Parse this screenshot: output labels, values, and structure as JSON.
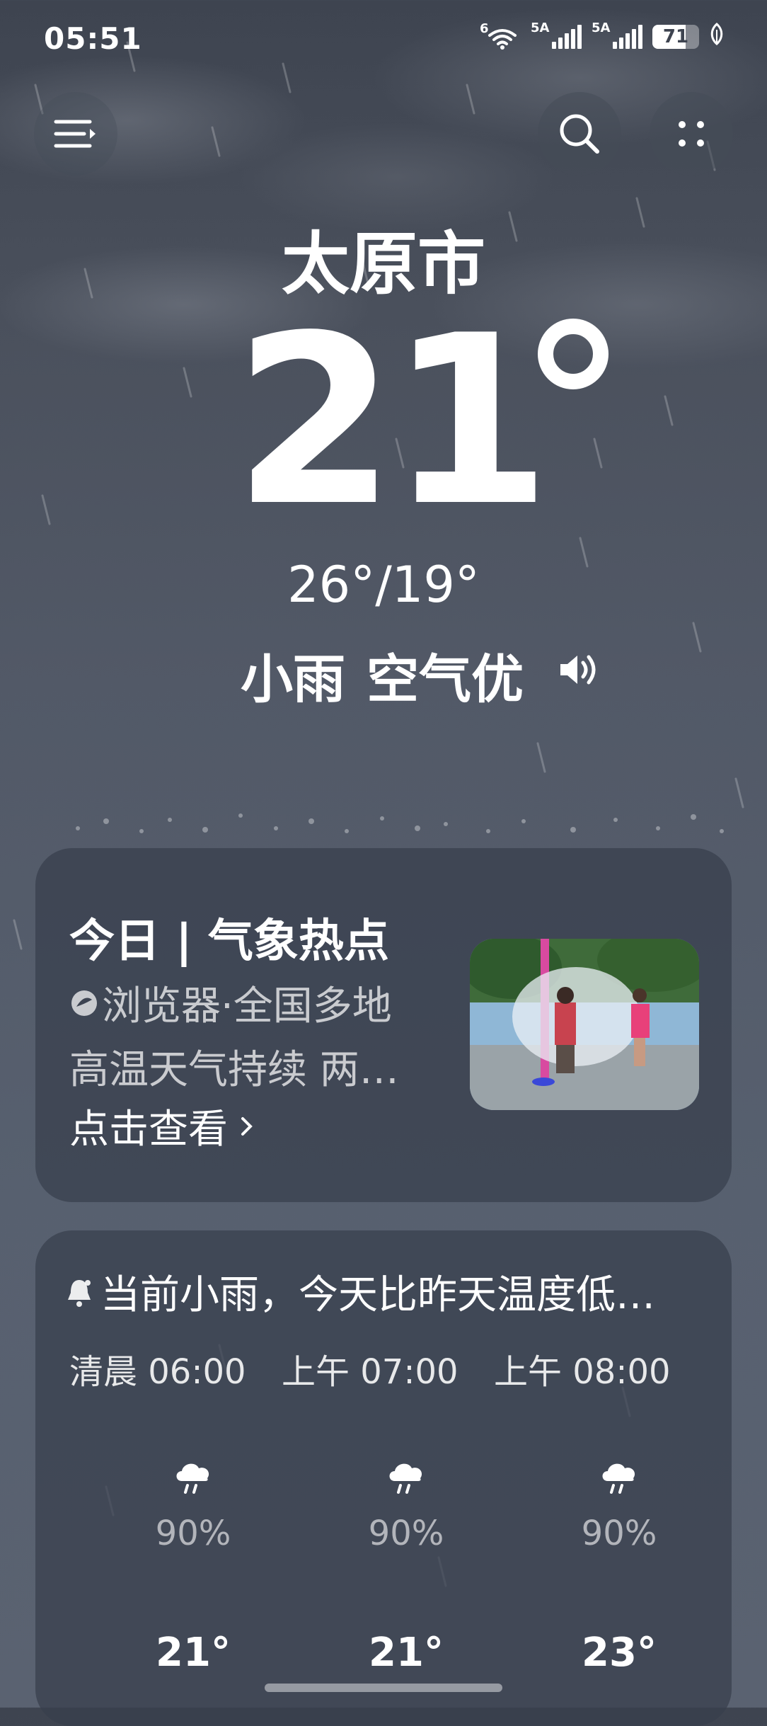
{
  "status_bar": {
    "time": "05:51",
    "wifi_label": "6",
    "signal1_label": "5A",
    "signal2_label": "5A",
    "battery": "71",
    "battery_level": 0.71
  },
  "header": {
    "city": "太原市",
    "menu_icon": "menu-icon",
    "search_icon": "search-icon",
    "more_icon": "grid-dots-icon"
  },
  "current": {
    "temperature": "21",
    "range": "26°/19°",
    "condition": "小雨",
    "air_quality": "空气优",
    "speaker_icon": "speaker-icon"
  },
  "hot_topic": {
    "title": "今日 | 气象热点",
    "line1": "浏览器·全国多地",
    "line2": "高温天气持续 两…",
    "link": "点击查看",
    "source_icon": "browser-icon"
  },
  "forecast": {
    "alert_icon": "bell-icon",
    "alert": "当前小雨，今天比昨天温度低…",
    "hours": [
      {
        "label": "清晨 06:00",
        "icon": "light-rain-icon",
        "probability": "90%",
        "temp": "21°"
      },
      {
        "label": "上午 07:00",
        "icon": "light-rain-icon",
        "probability": "90%",
        "temp": "21°"
      },
      {
        "label": "上午 08:00",
        "icon": "light-rain-icon",
        "probability": "90%",
        "temp": "23°"
      }
    ]
  },
  "colors": {
    "background_top": "#3e4450",
    "background_bottom": "#5a6271",
    "card": "#373e4c",
    "text": "#ffffff"
  }
}
